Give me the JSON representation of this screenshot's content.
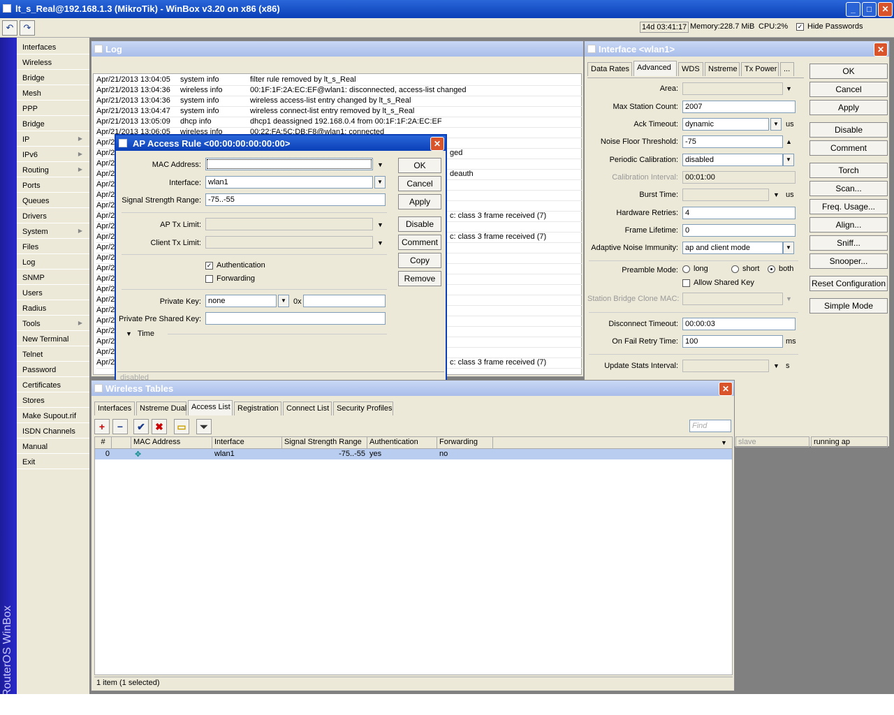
{
  "app": {
    "title": "lt_s_Real@192.168.1.3 (MikroTik) - WinBox v3.20 on x86 (x86)"
  },
  "toolbar": {
    "uptime": "14d 03:41:17",
    "memory_label": "Memory:",
    "memory_value": "228.7 MiB",
    "cpu_label": "CPU:",
    "cpu_value": "2%",
    "hide_passwords_label": "Hide Passwords"
  },
  "sidebar": {
    "vertical_title": "RouterOS WinBox",
    "items": [
      "Interfaces",
      "Wireless",
      "Bridge",
      "Mesh",
      "PPP",
      "Bridge",
      "IP",
      "IPv6",
      "Routing",
      "Ports",
      "Queues",
      "Drivers",
      "System",
      "Files",
      "Log",
      "SNMP",
      "Users",
      "Radius",
      "Tools",
      "New Terminal",
      "Telnet",
      "Password",
      "Certificates",
      "Stores",
      "Make Supout.rif",
      "ISDN Channels",
      "Manual",
      "Exit"
    ]
  },
  "log": {
    "title": "Log",
    "rows": [
      [
        "Apr/21/2013 13:04:05",
        "system info",
        "filter rule removed by lt_s_Real"
      ],
      [
        "Apr/21/2013 13:04:36",
        "wireless info",
        "00:1F:1F:2A:EC:EF@wlan1: disconnected, access-list changed"
      ],
      [
        "Apr/21/2013 13:04:36",
        "system info",
        "wireless access-list entry changed by lt_s_Real"
      ],
      [
        "Apr/21/2013 13:04:47",
        "system info",
        "wireless connect-list entry removed by lt_s_Real"
      ],
      [
        "Apr/21/2013 13:05:09",
        "dhcp info",
        "dhcp1 deassigned 192.168.0.4 from 00:1F:1F:2A:EC:EF"
      ],
      [
        "Apr/21/2013 13:06:05",
        "wireless info",
        "00:22:FA:5C:DB:F8@wlan1: connected"
      ]
    ],
    "partial_prefix": "Apr/2",
    "partial_fragments": [
      {
        "row": 7,
        "text": "ged"
      },
      {
        "row": 9,
        "text": "deauth"
      },
      {
        "row": 13,
        "text": "c: class 3 frame received (7)"
      },
      {
        "row": 15,
        "text": "c: class 3 frame received (7)"
      },
      {
        "row": 27,
        "text": "c: class 3 frame received (7)"
      }
    ]
  },
  "ap_rule": {
    "title": "AP Access Rule <00:00:00:00:00:00>",
    "mac_label": "MAC Address:",
    "mac_value": "",
    "interface_label": "Interface:",
    "interface_value": "wlan1",
    "signal_label": "Signal Strength Range:",
    "signal_value": "-75..-55",
    "ap_tx_label": "AP Tx Limit:",
    "client_tx_label": "Client Tx Limit:",
    "auth_label": "Authentication",
    "fwd_label": "Forwarding",
    "private_key_label": "Private Key:",
    "private_key_value": "none",
    "hex_prefix": "0x",
    "psk_label": "Private Pre Shared Key:",
    "time_label": "Time",
    "status": "disabled",
    "buttons": {
      "ok": "OK",
      "cancel": "Cancel",
      "apply": "Apply",
      "disable": "Disable",
      "comment": "Comment",
      "copy": "Copy",
      "remove": "Remove"
    }
  },
  "iface": {
    "title": "Interface <wlan1>",
    "tabs": [
      "Data Rates",
      "Advanced",
      "WDS",
      "Nstreme",
      "Tx Power",
      "..."
    ],
    "area_label": "Area:",
    "max_station_label": "Max Station Count:",
    "max_station_value": "2007",
    "ack_label": "Ack Timeout:",
    "ack_value": "dynamic",
    "us": "us",
    "noise_label": "Noise Floor Threshold:",
    "noise_value": "-75",
    "periodic_label": "Periodic Calibration:",
    "periodic_value": "disabled",
    "cal_int_label": "Calibration Interval:",
    "cal_int_value": "00:01:00",
    "burst_label": "Burst Time:",
    "hw_retries_label": "Hardware Retries:",
    "hw_retries_value": "4",
    "frame_life_label": "Frame Lifetime:",
    "frame_life_value": "0",
    "ani_label": "Adaptive Noise Immunity:",
    "ani_value": "ap and client mode",
    "preamble_label": "Preamble Mode:",
    "pre_long": "long",
    "pre_short": "short",
    "pre_both": "both",
    "shared_key_label": "Allow Shared Key",
    "sbc_label": "Station Bridge Clone MAC:",
    "disc_label": "Disconnect Timeout:",
    "disc_value": "00:00:03",
    "fail_label": "On Fail Retry Time:",
    "fail_value": "100",
    "ms": "ms",
    "update_label": "Update Stats Interval:",
    "s": "s",
    "status_left": "slave",
    "status_right": "running ap",
    "buttons": {
      "ok": "OK",
      "cancel": "Cancel",
      "apply": "Apply",
      "disable": "Disable",
      "comment": "Comment",
      "torch": "Torch",
      "scan": "Scan...",
      "freq": "Freq. Usage...",
      "align": "Align...",
      "sniff": "Sniff...",
      "snooper": "Snooper...",
      "reset": "Reset Configuration",
      "simple": "Simple Mode"
    }
  },
  "wt": {
    "title": "Wireless Tables",
    "tabs": [
      "Interfaces",
      "Nstreme Dual",
      "Access List",
      "Registration",
      "Connect List",
      "Security Profiles"
    ],
    "find_placeholder": "Find",
    "columns": [
      "#",
      "MAC Address",
      "Interface",
      "Signal Strength Range",
      "Authentication",
      "Forwarding"
    ],
    "row": {
      "num": "0",
      "mac": "",
      "iface": "wlan1",
      "signal": "-75..-55",
      "auth": "yes",
      "fwd": "no"
    },
    "status": "1 item (1 selected)"
  }
}
